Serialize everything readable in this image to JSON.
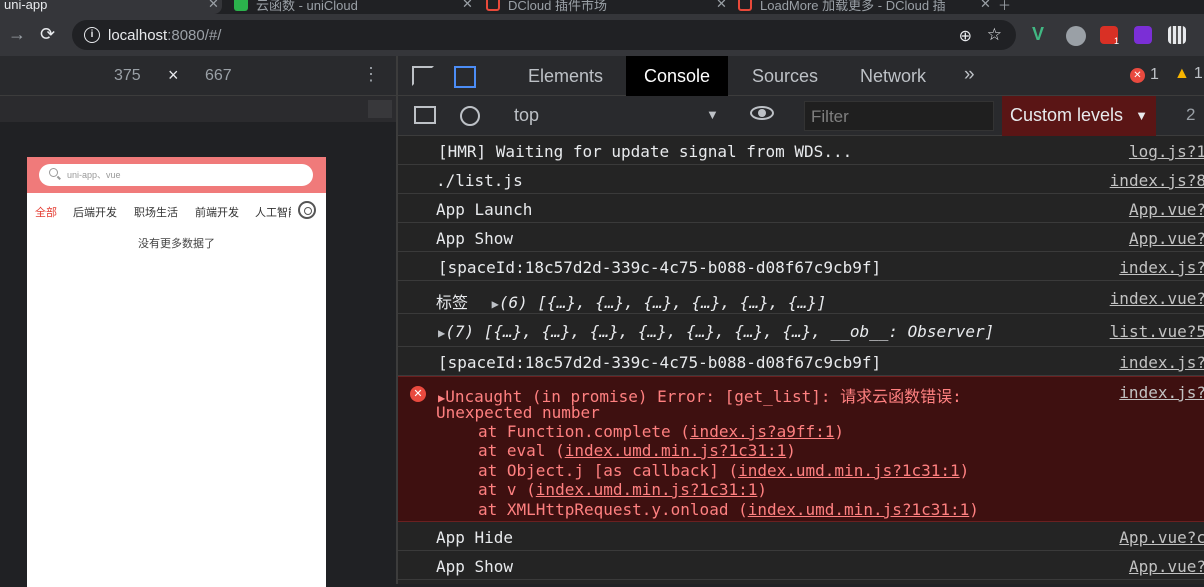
{
  "browser": {
    "tabs": [
      {
        "title": "uni-app",
        "active": true
      },
      {
        "title": "云函数 - uniCloud"
      },
      {
        "title": "DCloud 插件市场"
      },
      {
        "title": "LoadMore 加载更多 - DCloud 插"
      }
    ],
    "url_host": "localhost",
    "url_rest": ":8080/#/",
    "ext_badge": "1"
  },
  "device": {
    "width": "375",
    "height": "667",
    "times": "×",
    "search_placeholder": "uni-app、vue",
    "tabs": [
      "全部",
      "后端开发",
      "职场生活",
      "前端开发",
      "人工智能"
    ],
    "no_more": "没有更多数据了"
  },
  "devtools": {
    "tabs": [
      "Elements",
      "Console",
      "Sources",
      "Network"
    ],
    "more": "»",
    "errors": "1",
    "warnings": "1",
    "context": "top",
    "filter_placeholder": "Filter",
    "levels": "Custom levels",
    "hidden": "2"
  },
  "console": [
    {
      "msg": "[HMR] Waiting for update signal from WDS...",
      "src": "log.js?1"
    },
    {
      "msg": "./list.js",
      "src": "index.js?8"
    },
    {
      "msg": "App Launch",
      "src": "App.vue?"
    },
    {
      "msg": "App Show",
      "src": "App.vue?"
    },
    {
      "msg": "[spaceId:18c57d2d-339c-4c75-b088-d08f67c9cb9f]",
      "src": "index.js?"
    },
    {
      "label": "标签",
      "obj": "(6) [{…}, {…}, {…}, {…}, {…}, {…}]",
      "src": "index.vue?"
    },
    {
      "obj": "(7) [{…}, {…}, {…}, {…}, {…}, {…}, {…}, __ob__: Observer]",
      "src": "list.vue?5"
    },
    {
      "msg": "[spaceId:18c57d2d-339c-4c75-b088-d08f67c9cb9f]",
      "src": "index.js?"
    }
  ],
  "error": {
    "head": "Uncaught (in promise) Error: [get_list]: 请求云函数错误:",
    "line2": "Unexpected number",
    "stack": [
      {
        "pre": "at Function.complete (",
        "link": "index.js?a9ff:1",
        "post": ")"
      },
      {
        "pre": "at eval (",
        "link": "index.umd.min.js?1c31:1",
        "post": ")"
      },
      {
        "pre": "at Object.j [as callback] (",
        "link": "index.umd.min.js?1c31:1",
        "post": ")"
      },
      {
        "pre": "at v (",
        "link": "index.umd.min.js?1c31:1",
        "post": ")"
      },
      {
        "pre": "at XMLHttpRequest.y.onload (",
        "link": "index.umd.min.js?1c31:1",
        "post": ")"
      }
    ],
    "src": "index.js?"
  },
  "console_after": [
    {
      "msg": "App Hide",
      "src": "App.vue?c"
    },
    {
      "msg": "App Show",
      "src": "App.vue?"
    }
  ]
}
